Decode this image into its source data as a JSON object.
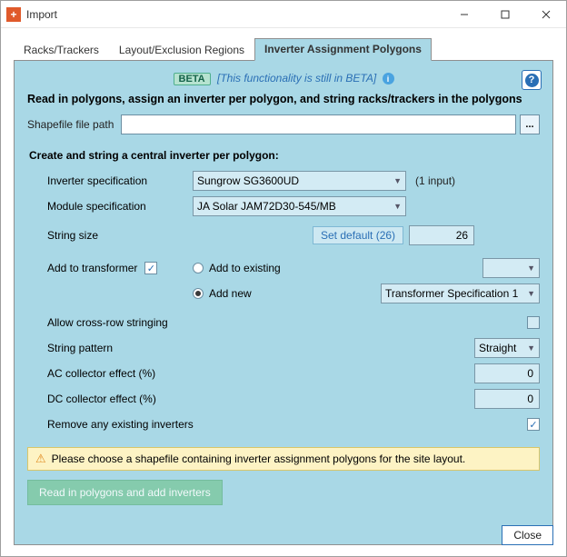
{
  "window": {
    "title": "Import"
  },
  "tabs": {
    "items": [
      {
        "label": "Racks/Trackers"
      },
      {
        "label": "Layout/Exclusion Regions"
      },
      {
        "label": "Inverter Assignment Polygons"
      }
    ],
    "active_index": 2
  },
  "beta": {
    "badge": "BETA",
    "text": "[This functionality is still in BETA]"
  },
  "headline": "Read in polygons, assign an inverter per polygon, and string racks/trackers in the polygons",
  "filepath": {
    "label": "Shapefile file path",
    "value": "",
    "browse": "..."
  },
  "section_title": "Create and string a central inverter per polygon:",
  "form": {
    "inverter_label": "Inverter specification",
    "inverter_value": "Sungrow SG3600UD",
    "inverter_note": "(1 input)",
    "module_label": "Module specification",
    "module_value": "JA Solar JAM72D30-545/MB",
    "string_label": "String size",
    "string_default_btn": "Set default (26)",
    "string_value": "26",
    "add_transformer_label": "Add to transformer",
    "add_transformer_checked": true,
    "radio_existing": "Add to existing",
    "radio_new": "Add new",
    "radio_selected": "new",
    "transformer_spec": "Transformer Specification 1",
    "allow_cross_label": "Allow cross-row stringing",
    "allow_cross_checked": false,
    "pattern_label": "String pattern",
    "pattern_value": "Straight",
    "ac_label": "AC collector effect (%)",
    "ac_value": "0",
    "dc_label": "DC collector effect (%)",
    "dc_value": "0",
    "remove_label": "Remove any existing inverters",
    "remove_checked": true
  },
  "warning": "Please choose a shapefile containing inverter assignment polygons for the site layout.",
  "action_button": "Read in polygons and add inverters",
  "footer": {
    "close": "Close"
  }
}
